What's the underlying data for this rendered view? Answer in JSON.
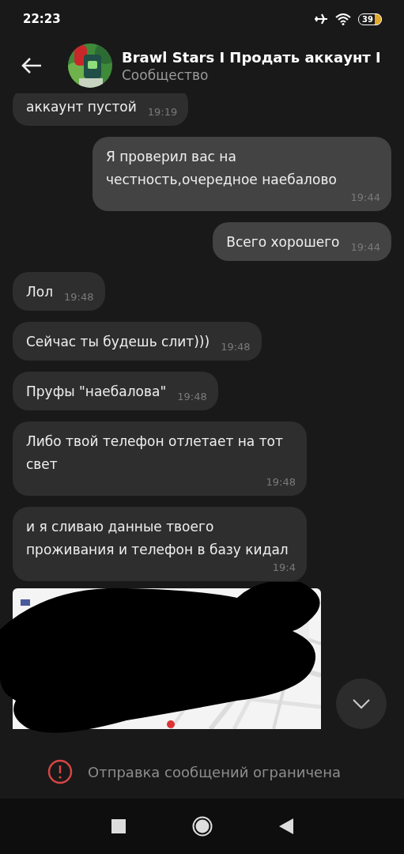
{
  "status_bar": {
    "time": "22:23",
    "battery": "39"
  },
  "header": {
    "title": "Brawl Stars I Продать аккаунт I",
    "subtitle": "Сообщество"
  },
  "messages": [
    {
      "text": "аккаунт пустой",
      "time": "19:19",
      "outgoing": false
    },
    {
      "text": "Я проверил вас на честность,очередное наебалово",
      "time": "19:44",
      "outgoing": true
    },
    {
      "text": "Всего хорошего",
      "time": "19:44",
      "outgoing": true
    },
    {
      "text": "Лол",
      "time": "19:48",
      "outgoing": false
    },
    {
      "text": "Сейчас ты будешь слит)))",
      "time": "19:48",
      "outgoing": false
    },
    {
      "text": "Пруфы \"наебалова\"",
      "time": "19:48",
      "outgoing": false
    },
    {
      "text": "Либо твой телефон отлетает на тот свет",
      "time": "19:48",
      "outgoing": false
    },
    {
      "text": "и я сливаю данные твоего проживания и телефон в базу кидал",
      "time": "19:4",
      "outgoing": false
    }
  ],
  "footer": {
    "notice": "Отправка сообщений ограничена"
  }
}
